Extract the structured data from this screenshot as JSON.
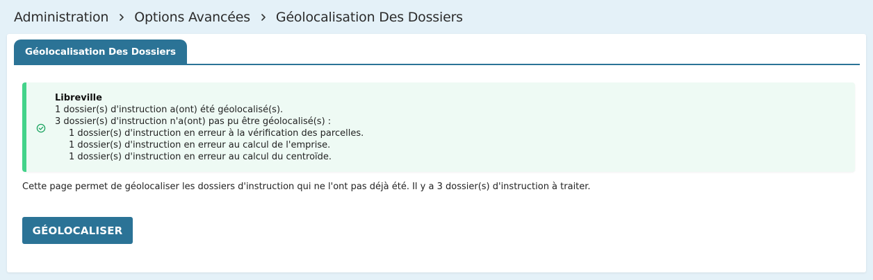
{
  "breadcrumb": {
    "items": [
      "Administration",
      "Options Avancées",
      "Géolocalisation Des Dossiers"
    ]
  },
  "tabs": [
    {
      "label": "Géolocalisation Des Dossiers",
      "active": true
    }
  ],
  "message": {
    "type": "success",
    "icon": "check-circle-icon",
    "title": "Libreville",
    "lines": [
      "1 dossier(s) d'instruction a(ont) été géolocalisé(s).",
      "3 dossier(s) d'instruction n'a(ont) pas pu être géolocalisé(s) :"
    ],
    "details": [
      "1 dossier(s) d'instruction en erreur à la vérification des parcelles.",
      "1 dossier(s) d'instruction en erreur au calcul de l'emprise.",
      "1 dossier(s) d'instruction en erreur au calcul du centroïde."
    ]
  },
  "description": "Cette page permet de géolocaliser les dossiers d'instruction qui ne l'ont pas déjà été. Il y a 3 dossier(s) d'instruction à traiter.",
  "button": {
    "label": "GÉOLOCALISER"
  },
  "colors": {
    "background": "#e4f1f8",
    "accent": "#2b7396",
    "success_border": "#43d38a",
    "success_bg": "#eefaf4",
    "success_icon": "#1aa35f"
  }
}
